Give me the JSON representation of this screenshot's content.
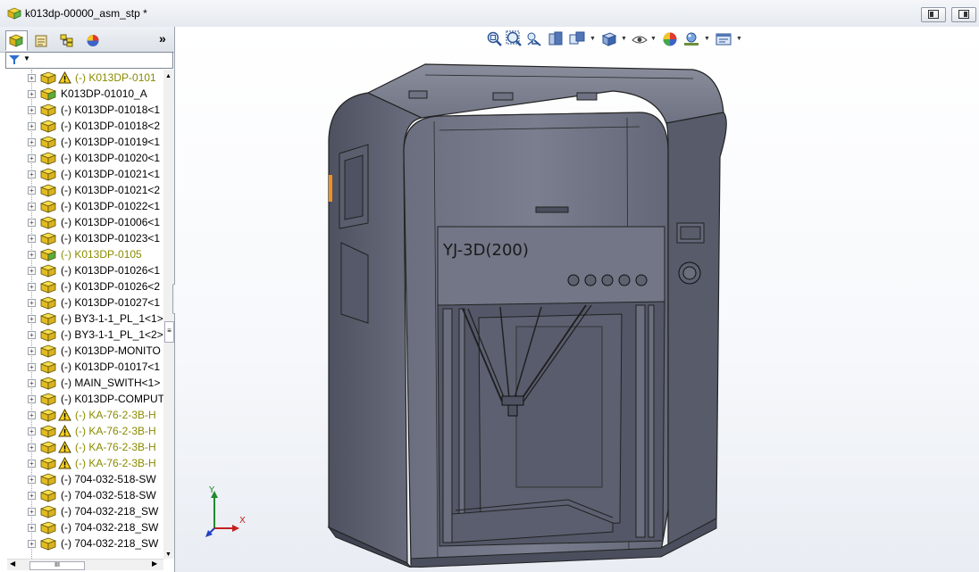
{
  "window": {
    "title": "k013dp-00000_asm_stp *"
  },
  "feature_manager": {
    "tabs": [
      {
        "name": "featuremanager-tab",
        "icon": "assembly-tree-icon"
      },
      {
        "name": "propertymanager-tab",
        "icon": "property-icon"
      },
      {
        "name": "configurationmanager-tab",
        "icon": "configuration-icon"
      },
      {
        "name": "appearance-tab",
        "icon": "appearance-icon"
      }
    ],
    "expand_label": "»",
    "items": [
      {
        "label": "(-) K013DP-0101",
        "warn": true,
        "olive": true
      },
      {
        "label": "K013DP-01010_A",
        "warn": false,
        "olive": false,
        "green": true
      },
      {
        "label": "(-) K013DP-01018<1",
        "warn": false,
        "olive": false
      },
      {
        "label": "(-) K013DP-01018<2",
        "warn": false,
        "olive": false
      },
      {
        "label": "(-) K013DP-01019<1",
        "warn": false,
        "olive": false
      },
      {
        "label": "(-) K013DP-01020<1",
        "warn": false,
        "olive": false
      },
      {
        "label": "(-) K013DP-01021<1",
        "warn": false,
        "olive": false
      },
      {
        "label": "(-) K013DP-01021<2",
        "warn": false,
        "olive": false
      },
      {
        "label": "(-) K013DP-01022<1",
        "warn": false,
        "olive": false
      },
      {
        "label": "(-) K013DP-01006<1",
        "warn": false,
        "olive": false
      },
      {
        "label": "(-) K013DP-01023<1",
        "warn": false,
        "olive": false
      },
      {
        "label": "(-) K013DP-0105",
        "warn": false,
        "olive": true,
        "green": true
      },
      {
        "label": "(-) K013DP-01026<1",
        "warn": false,
        "olive": false
      },
      {
        "label": "(-) K013DP-01026<2",
        "warn": false,
        "olive": false
      },
      {
        "label": "(-) K013DP-01027<1",
        "warn": false,
        "olive": false
      },
      {
        "label": "(-) BY3-1-1_PL_1<1>",
        "warn": false,
        "olive": false
      },
      {
        "label": "(-) BY3-1-1_PL_1<2>",
        "warn": false,
        "olive": false
      },
      {
        "label": "(-) K013DP-MONITO",
        "warn": false,
        "olive": false
      },
      {
        "label": "(-) K013DP-01017<1",
        "warn": false,
        "olive": false
      },
      {
        "label": "(-) MAIN_SWITH<1>",
        "warn": false,
        "olive": false
      },
      {
        "label": "(-) K013DP-COMPUT",
        "warn": false,
        "olive": false
      },
      {
        "label": "(-) KA-76-2-3B-H",
        "warn": true,
        "olive": true
      },
      {
        "label": "(-) KA-76-2-3B-H",
        "warn": true,
        "olive": true
      },
      {
        "label": "(-) KA-76-2-3B-H",
        "warn": true,
        "olive": true
      },
      {
        "label": "(-) KA-76-2-3B-H",
        "warn": true,
        "olive": true
      },
      {
        "label": "(-) 704-032-518-SW",
        "warn": false,
        "olive": false
      },
      {
        "label": "(-) 704-032-518-SW",
        "warn": false,
        "olive": false
      },
      {
        "label": "(-) 704-032-218_SW",
        "warn": false,
        "olive": false
      },
      {
        "label": "(-) 704-032-218_SW",
        "warn": false,
        "olive": false
      },
      {
        "label": "(-) 704-032-218_SW",
        "warn": false,
        "olive": false
      }
    ],
    "hscroll_thumb": "III"
  },
  "viewport": {
    "model_label": "YJ-3D(200)",
    "triad": {
      "x": "X",
      "y": "Y"
    },
    "heads_up_icons": [
      "zoom-to-fit-icon",
      "zoom-to-area-icon",
      "previous-view-icon",
      "section-view-icon",
      "view-orientation-icon",
      "display-style-icon",
      "hide-show-icon",
      "edit-appearance-icon",
      "apply-scene-icon",
      "view-settings-icon"
    ]
  },
  "colors": {
    "model_gray": "#5b5f6e",
    "olive_text": "#8a8a00",
    "accent_orange": "#f0901e"
  }
}
